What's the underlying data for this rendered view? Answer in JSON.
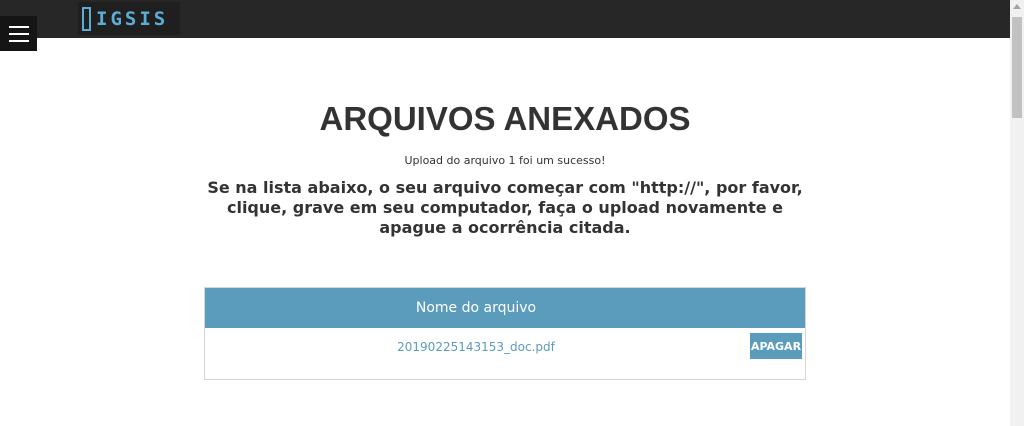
{
  "header": {
    "logo_text": "IGSIS",
    "menu_icon": "hamburger-menu-icon"
  },
  "main": {
    "title": "ARQUIVOS ANEXADOS",
    "success_message": "Upload do arquivo 1 foi um sucesso!",
    "notice": "Se na lista abaixo, o seu arquivo começar com \"http://\", por favor, clique, grave em seu computador, faça o upload novamente e apague a ocorrência citada."
  },
  "table": {
    "columns": [
      "Nome do arquivo"
    ],
    "rows": [
      {
        "filename": "20190225143153_doc.pdf",
        "action_label": "APAGAR"
      }
    ]
  },
  "colors": {
    "header_bg": "#272727",
    "accent": "#5b9cbd",
    "logo": "#5aaed5",
    "text": "#333333"
  }
}
